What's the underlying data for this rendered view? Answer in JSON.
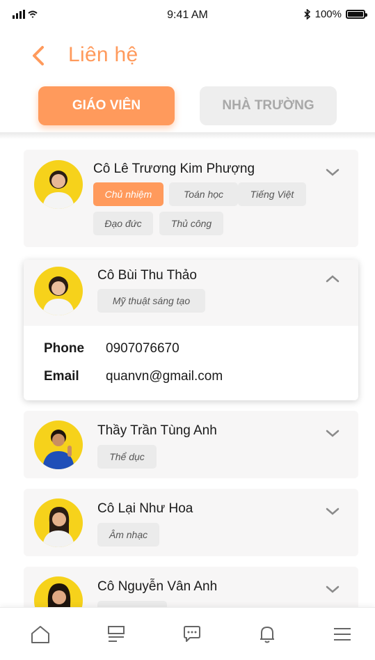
{
  "status": {
    "time": "9:41 AM",
    "battery": "100%"
  },
  "header": {
    "title": "Liên hệ"
  },
  "tabs": [
    {
      "label": "GIÁO VIÊN",
      "active": true
    },
    {
      "label": "NHÀ TRƯỜNG",
      "active": false
    }
  ],
  "contacts": [
    {
      "name": "Cô Lê Trương Kim Phượng",
      "tags": [
        "Chủ nhiệm",
        "Toán học",
        "Tiếng Việt",
        "Đạo đức",
        "Thủ công"
      ],
      "expanded": false
    },
    {
      "name": "Cô Bùi Thu Thảo",
      "tags": [
        "Mỹ thuật sáng tạo"
      ],
      "expanded": true,
      "details": {
        "phone_label": "Phone",
        "phone": "0907076670",
        "email_label": "Email",
        "email": "quanvn@gmail.com"
      }
    },
    {
      "name": "Thầy Trần Tùng Anh",
      "tags": [
        "Thể dục"
      ],
      "expanded": false
    },
    {
      "name": "Cô Lại Như Hoa",
      "tags": [
        "Âm nhạc"
      ],
      "expanded": false
    },
    {
      "name": "Cô Nguyễn Vân Anh",
      "tags": [
        ""
      ],
      "expanded": false
    }
  ],
  "bottom_nav": [
    "home-icon",
    "news-icon",
    "chat-icon",
    "bell-icon",
    "menu-icon"
  ],
  "colors": {
    "accent": "#ff9a5c",
    "avatar_bg": "#f6d21b",
    "card_bg": "#f7f6f6",
    "tag_bg": "#ebebeb"
  }
}
